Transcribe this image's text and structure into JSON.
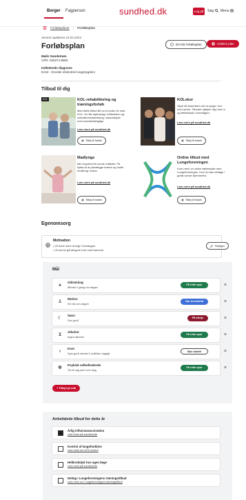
{
  "header": {
    "tabs": [
      "Borger",
      "Fagperson"
    ],
    "logo": "sundhed.dk",
    "login": "Log på",
    "links": [
      "Søg",
      "Menu"
    ]
  },
  "breadcrumb": [
    "Forløbsplaner",
    "Forløbsplan"
  ],
  "meta": {
    "date": "Senest opdateret 18.03.2024",
    "title": "Forløbsplan",
    "patient_label": "Malin Sundstrøm",
    "patient_cpr": "CPR: 030374-8950",
    "diagnosis_label": "Indledende diagnose",
    "diagnosis_value": "DJ44 - Kronisk obstruktiv lungesygdom",
    "btn_notes": "Del din forløbsplan",
    "btn_red": "Udskriv plan"
  },
  "tilbud": {
    "title": "Tilbud til dig",
    "cards": [
      {
        "title": "KOL-rehabilitering og træningsforløb",
        "text": "Med dette tilbud får du et bedre liv med KOL. Du får vejledning i luftfunktion og udholdenhedstræning i samarbejde med sundhedsfaglige.",
        "link": "Læs mere på sundhed.dk",
        "btn": "Tilføj til forløb",
        "badge": "KOL"
      },
      {
        "title": "KOLskor",
        "text": "Styrk dit åndedræt ved at synge i kor med andre. Tilbudet hjælper dig med ro og fællesskab i hverdagen.",
        "link": "Læs mere på sundhed.dk",
        "btn": "Tilføj til forløb"
      },
      {
        "title": "Madlyngs",
        "text": "Bliv inspireret til sunde måltider. Få hjælp til at planlægge kosten og holde ernæring i fokus.",
        "link": "Læs mere på sundhed.dk",
        "btn": "Tilføj til forløb"
      },
      {
        "title": "Online tilbud med Lungeforeningen",
        "text": "Kom med i et online fællesskab med Lungeforeningen, hvor du kan deltage i gratis kurser hjemmefra.",
        "link": "Læs mere på sundhed.dk",
        "btn": "Tilføj til forløb"
      }
    ]
  },
  "egenomsorg": {
    "title": "Egenomsorg",
    "motivation_title": "Motivation",
    "motivation_lines": [
      "Vil have mere energi i hverdagen.",
      "Vil kunne gå længere ture med børnene."
    ],
    "edit_btn": "Rediger"
  },
  "maal": {
    "title": "Mål",
    "goals": [
      {
        "icon": "activity",
        "title": "Gåtræning",
        "sub": "Mindst 1 gang om dagen",
        "pill": "På rette spor",
        "color": "#1f7a4c"
      },
      {
        "icon": "walk",
        "title": "Motion",
        "sub": "30 min om dagen",
        "pill": "Gør fremskridt",
        "color": "#3d6fd8"
      },
      {
        "icon": "sleep",
        "title": "Søvn",
        "sub": "Sov godt",
        "pill": "På afveje",
        "color": "#8b1a2f"
      },
      {
        "icon": "alcohol",
        "title": "Alkohol",
        "sub": "Ingen alkohol",
        "pill": "På rette spor",
        "color": "#1f7a4c"
      },
      {
        "icon": "food",
        "title": "Kost",
        "sub": "Spis godt mindst 3 måltider dagligt",
        "pill": "Ikke startet",
        "color": "#ffffff"
      },
      {
        "icon": "mind",
        "title": "Psykisk velbefindende",
        "sub": "Tid til mig selv hver dag",
        "pill": "På rette spor",
        "color": "#1f7a4c"
      }
    ],
    "add_btn": "Tilføj nyt mål"
  },
  "anbefalede": {
    "title": "Anbefalede tilbud for dette år",
    "items": [
      {
        "title": "Årlig influenzavaccination",
        "link": "Læs mere på sundhed.dk",
        "checked": true
      },
      {
        "title": "Kontrol af lungefunktion",
        "link": "Læs mere om KOL-kontrol",
        "checked": false
      },
      {
        "title": "Helbredstjek hos egen læge",
        "link": "Læs mere på sundhed.dk",
        "checked": false
      },
      {
        "title": "Deltag i Lungeforeningens træningstilbud",
        "link": "Læs mere om Lungeforeningens træningstilbud",
        "checked": false
      }
    ]
  }
}
